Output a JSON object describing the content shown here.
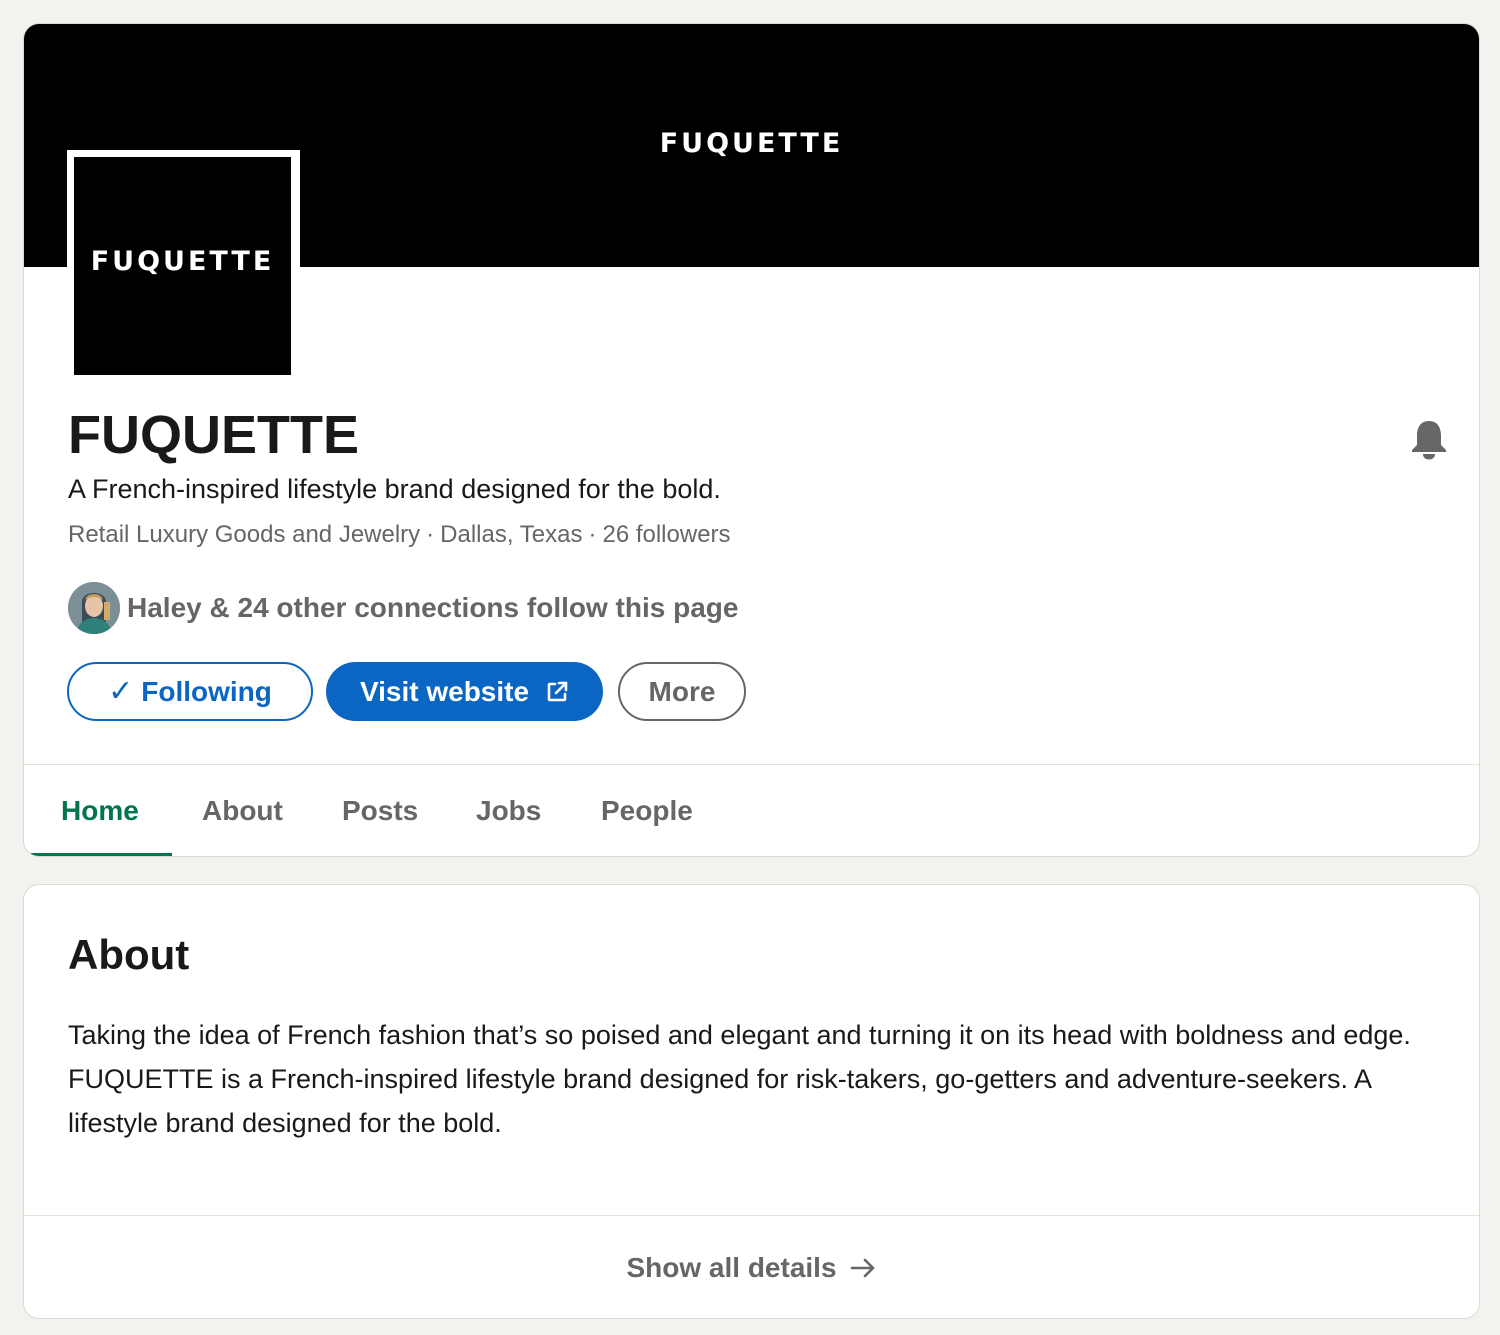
{
  "colors": {
    "primary_blue": "#0a66c2",
    "active_tab_green": "#01754f",
    "secondary_text": "#666666",
    "banner_black": "#000000",
    "page_background": "#f4f2ee"
  },
  "banner": {
    "wordmark": "FUQUETTE"
  },
  "logo": {
    "wordmark": "FUQUETTE"
  },
  "company": {
    "name": "FUQUETTE",
    "tagline": "A French-inspired lifestyle brand designed for the bold.",
    "industry": "Retail Luxury Goods and Jewelry",
    "location": "Dallas, Texas",
    "followers": "26 followers",
    "separator": "·"
  },
  "notification": {
    "icon": "bell-icon"
  },
  "connections": {
    "text": "Haley & 24 other connections follow this page",
    "avatar_icon": "avatar-photo"
  },
  "actions": {
    "following_check": "✓",
    "following_label": "Following",
    "visit_label": "Visit website",
    "visit_icon": "external-link-icon",
    "more_label": "More"
  },
  "tabs": [
    {
      "label": "Home",
      "active": true
    },
    {
      "label": "About",
      "active": false
    },
    {
      "label": "Posts",
      "active": false
    },
    {
      "label": "Jobs",
      "active": false
    },
    {
      "label": "People",
      "active": false
    }
  ],
  "about": {
    "title": "About",
    "body": "Taking the idea of French fashion that’s so poised and elegant and turning it on its head with boldness and edge. FUQUETTE is a French-inspired lifestyle brand designed for risk-takers, go-getters and adventure-seekers. A lifestyle brand designed for the bold.",
    "show_all_label": "Show all details",
    "show_all_icon": "arrow-right-icon"
  }
}
